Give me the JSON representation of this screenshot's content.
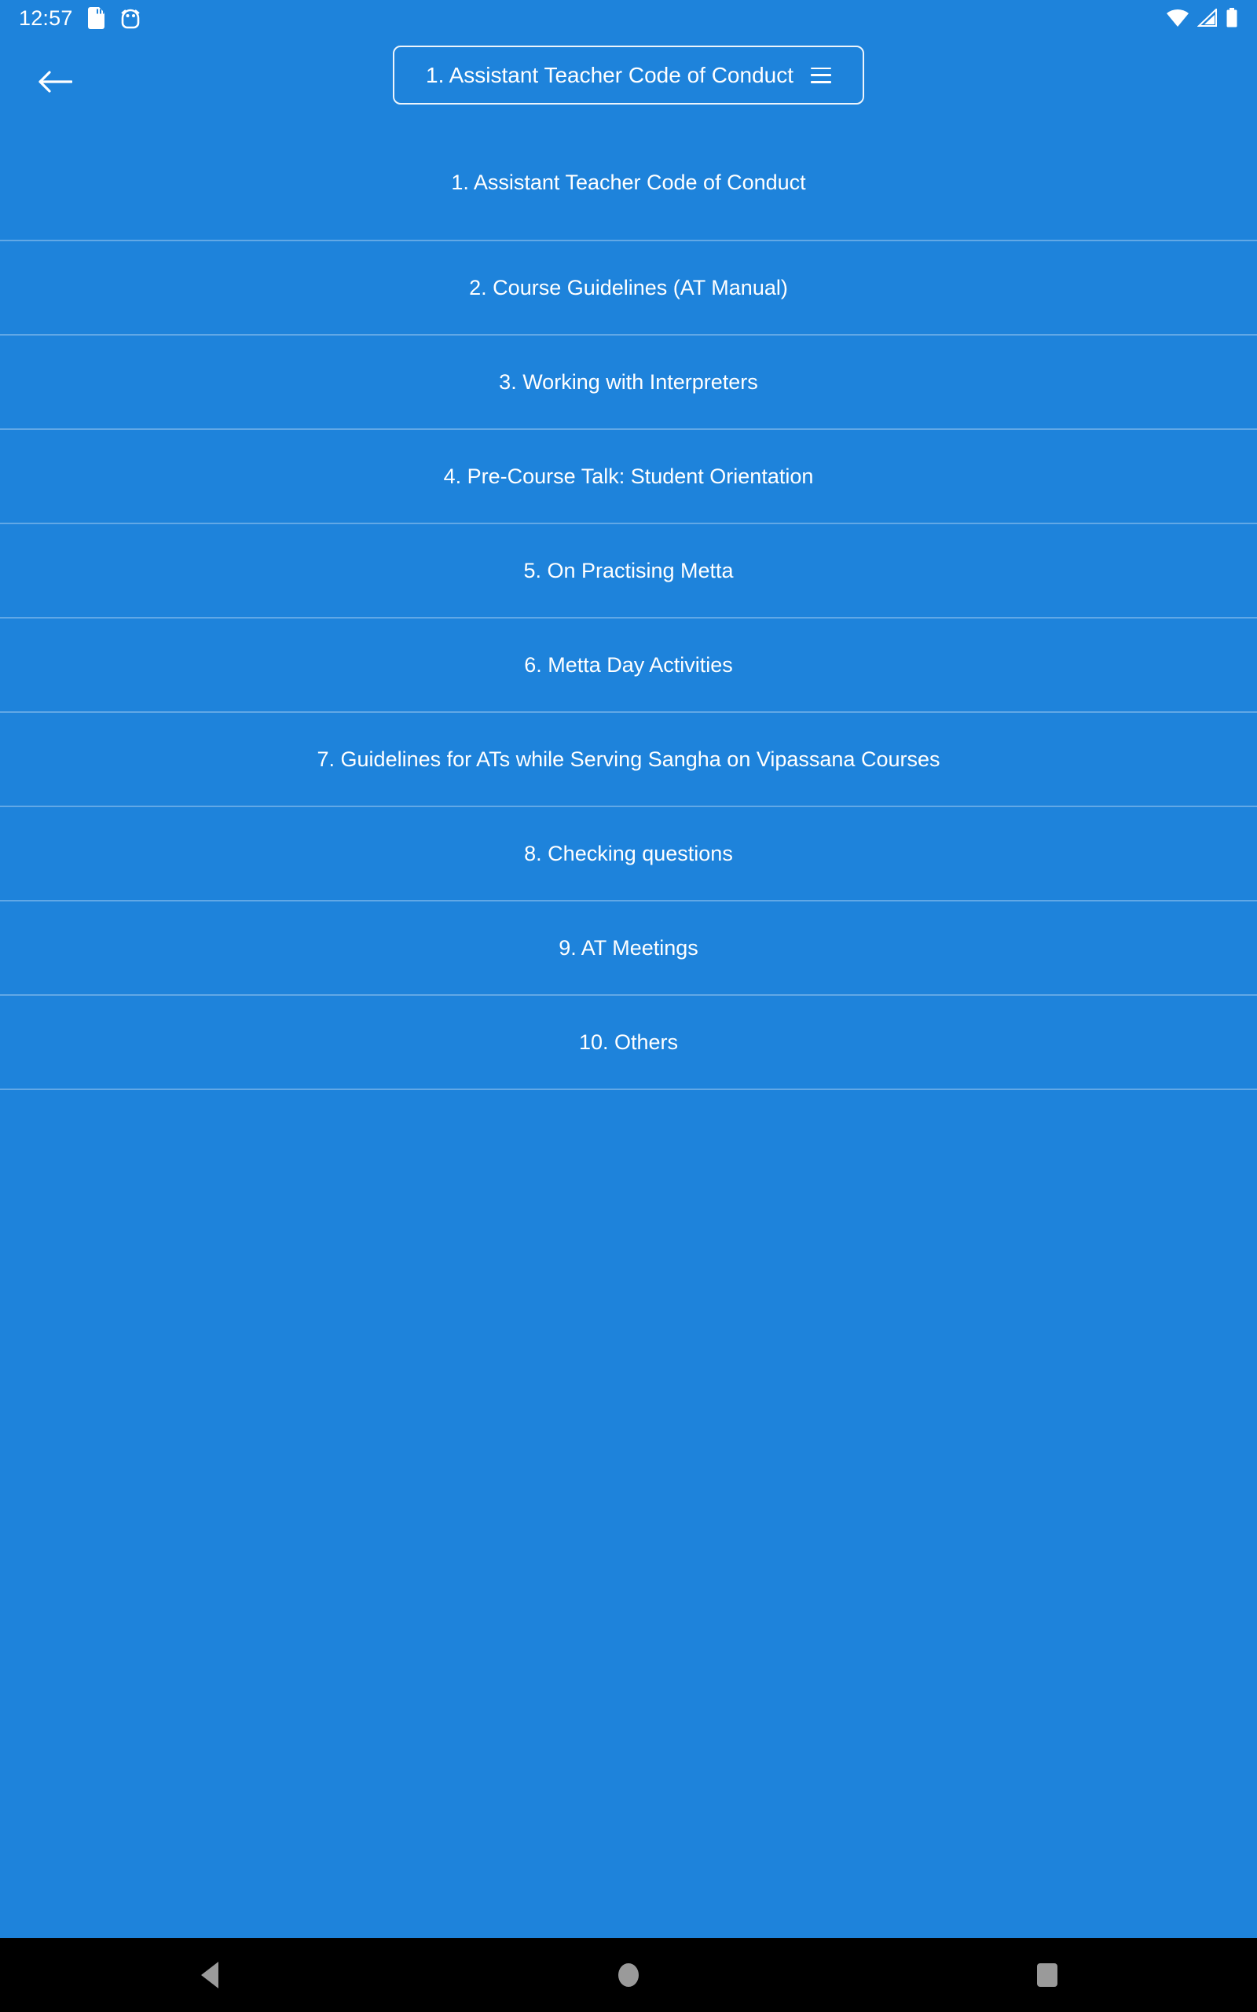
{
  "status_bar": {
    "clock": "12:57",
    "icons_left": [
      "sd-card-icon",
      "android-head-icon"
    ],
    "icons_right": [
      "wifi-icon",
      "cellular-signal-icon",
      "battery-icon"
    ]
  },
  "app_bar": {
    "back_icon": "back-arrow-icon",
    "spinner_label": "1. Assistant Teacher Code of Conduct",
    "spinner_menu_icon": "hamburger-menu-icon"
  },
  "list": {
    "items": [
      {
        "label": "1. Assistant Teacher Code of Conduct"
      },
      {
        "label": "2. Course Guidelines (AT Manual)"
      },
      {
        "label": "3. Working with Interpreters"
      },
      {
        "label": "4. Pre-Course Talk: Student Orientation"
      },
      {
        "label": "5. On Practising Metta"
      },
      {
        "label": "6. Metta Day Activities"
      },
      {
        "label": "7. Guidelines for ATs while Serving Sangha on Vipassana Courses"
      },
      {
        "label": "8. Checking questions"
      },
      {
        "label": "9. AT Meetings"
      },
      {
        "label": "10. Others"
      }
    ]
  },
  "nav_bar": {
    "back_label": "Back",
    "home_label": "Home",
    "recents_label": "Recents"
  },
  "colors": {
    "background": "#1E83DB",
    "text": "#FFFFFF",
    "divider": "rgba(255,255,255,0.30)",
    "nav_bar": "#000000",
    "nav_icon": "#9A9A9A"
  }
}
